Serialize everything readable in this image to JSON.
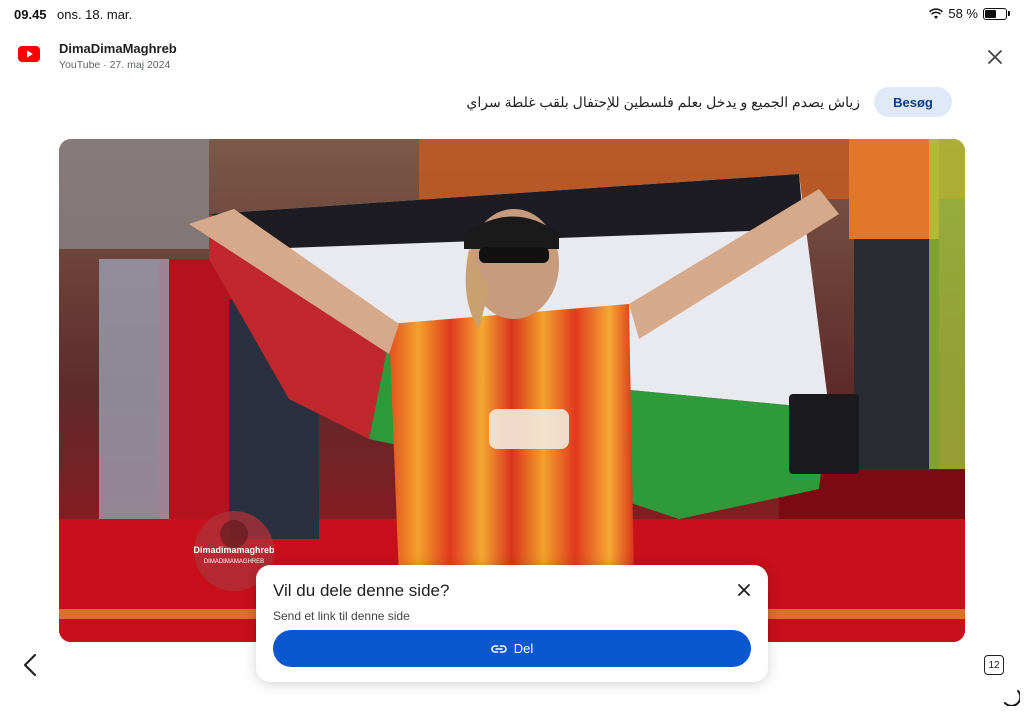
{
  "status": {
    "time": "09.45",
    "date": "ons. 18. mar.",
    "battery": "58 %",
    "battery_level": 0.58
  },
  "source": {
    "name": "DimaDimaMaghreb",
    "meta": "YouTube · 27. maj 2024"
  },
  "article": {
    "title": "زياش يصدم الجميع و يدخل بعلم فلسطين للإحتفال بلقب غلطة سراي",
    "visit_label": "Besøg"
  },
  "media": {
    "watermark_name": "Dimadimamaghreb",
    "watermark_sub": "DIMADIMAMAGHREB"
  },
  "share": {
    "title": "Vil du dele denne side?",
    "subtitle": "Send et link til denne side",
    "button_label": "Del"
  },
  "nav": {
    "tab_count": "12"
  },
  "colors": {
    "accent": "#0b57d0",
    "visit_bg": "#dfe9f8",
    "youtube_red": "#ff0000"
  },
  "icons": [
    "youtube-icon",
    "close-icon",
    "wifi-icon",
    "battery-icon",
    "link-icon",
    "back-icon",
    "tabs-icon",
    "spinner-icon"
  ]
}
